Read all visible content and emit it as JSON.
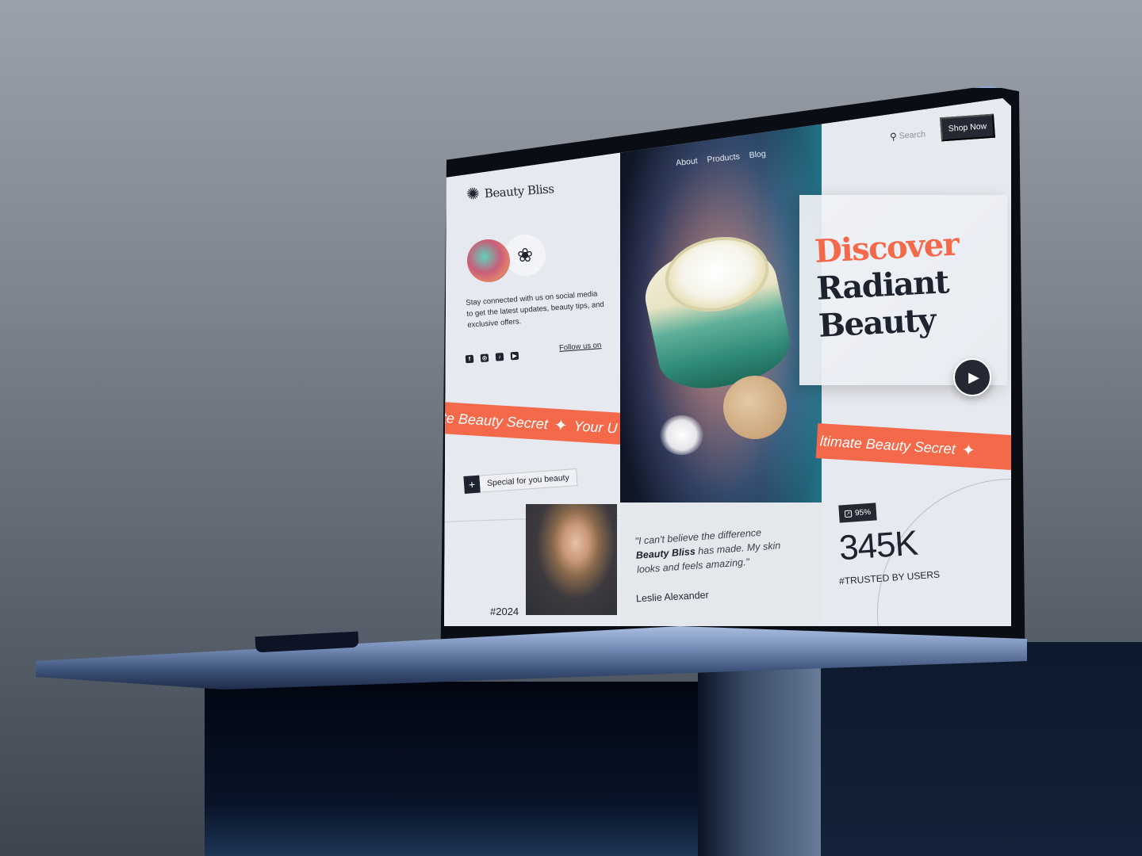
{
  "brand": {
    "name": "Beauty Bliss",
    "logo_icon": "flower-icon"
  },
  "nav": {
    "links": [
      "About",
      "Products",
      "Blog"
    ]
  },
  "header": {
    "search_label": "Search",
    "search_icon": "search-icon",
    "cta_label": "Shop Now"
  },
  "social": {
    "description": "Stay connected with us on social media to get the latest updates, beauty tips, and exclusive offers.",
    "follow_label": "Follow us on",
    "icons": [
      "facebook-icon",
      "instagram-icon",
      "tiktok-icon",
      "youtube-icon"
    ]
  },
  "ribbon": {
    "left_text": "te Beauty Secret",
    "left_trailing": "Your U",
    "right_text": "ltimate Beauty Secret"
  },
  "special": {
    "label": "Special for you beauty"
  },
  "hero": {
    "line1": "Discover",
    "line2": "Radiant",
    "line3": "Beauty",
    "accent_color": "#f3694a",
    "play_icon": "play-icon"
  },
  "testimonial": {
    "quote_before": "\"I can't believe the difference ",
    "quote_brand": "Beauty Bliss",
    "quote_after": " has made. My skin looks and feels amazing.\"",
    "author": "Leslie Alexander",
    "year_tag": "#2024"
  },
  "stats": {
    "badge_value": "95%",
    "value": "345K",
    "label": "#TRUSTED BY USERS"
  },
  "colors": {
    "accent": "#f3694a",
    "dark": "#232833",
    "panel": "#e6e9ef"
  }
}
